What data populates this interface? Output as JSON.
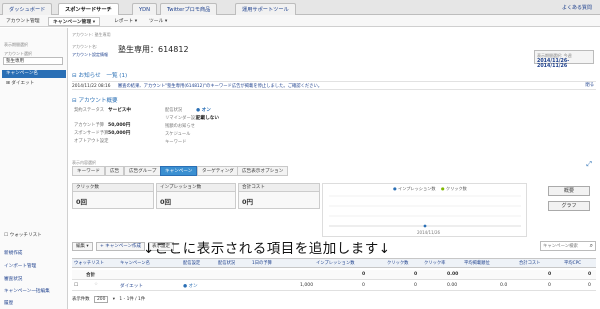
{
  "top_tabs": [
    "ダッシュボード",
    "スポンサードサーチ",
    "YDN",
    "Twitterプロモ商品",
    "運用サポートツール"
  ],
  "top_link": "よくある質問",
  "sub_menu": [
    "アカウント管理",
    "キャンペーン管理 ▾",
    "レポート ▾",
    "ツール ▾"
  ],
  "sidebar": {
    "label1": "表示期間選択",
    "label2": "アカウント選択",
    "account_select": "塾生専用",
    "tabs": [
      "キャンペーン名",
      "ダイエット"
    ],
    "watchlist": "ウォッチリスト",
    "links": [
      "新規作成",
      "インポート管理",
      "審査状況",
      "キャンペーン一括編集",
      "履歴"
    ]
  },
  "header": {
    "breadcrumb": "アカウント: 塾生専用",
    "acct_label1": "アカウント名:",
    "acct_label2": "アカウント設定情報",
    "acct_name": "塾生専用：614812",
    "date_label": "表示期間選択: 今週",
    "date_range": "2014/11/26-2014/11/26"
  },
  "notice": {
    "title": "お知らせ",
    "title_detail": "一覧 (1)",
    "date": "2014/11/22 08:16",
    "text": "審査の結果、アカウント\"塾生専用(614812)\"のキーワード広告が掲載を停止しました。ご確認ください。",
    "link": "閉る"
  },
  "acct_info": {
    "title": "アカウント概要",
    "keys": [
      "契約ステータス",
      "アカウント予算",
      "スポンサード予算",
      "オプトアウト設定"
    ],
    "vals": [
      "サービス中",
      "50,000円",
      "50,000円",
      ""
    ],
    "keys2": [
      "配信状況",
      "リマインダー設定",
      "残額のお知らせ",
      "スケジュール",
      "キーワード"
    ],
    "vals2": [
      "● オン",
      "記載しない",
      "",
      "",
      ""
    ]
  },
  "content_tabs": {
    "label": "表示内容選択",
    "items": [
      "キーワード",
      "広告",
      "広告グループ",
      "キャンペーン",
      "ターゲティング",
      "広告表示オプション"
    ],
    "active_index": 3
  },
  "metrics": [
    {
      "label": "クリック数",
      "value": "0回"
    },
    {
      "label": "インプレッション数",
      "value": "0回"
    },
    {
      "label": "合計コスト",
      "value": "0円"
    }
  ],
  "graph": {
    "legend": [
      "インプレッション数",
      "クリック数"
    ],
    "date": "2014/11/26"
  },
  "graph_buttons": [
    "概要",
    "グラフ"
  ],
  "toolbar": [
    "編集 ▾",
    "キャンペーン作成",
    "表示設定"
  ],
  "search_placeholder": "キャンペーン検索",
  "overlay_text": "↓ここに表示される項目を追加します↓",
  "table": {
    "headers": [
      "ウォッチリスト",
      "キャンペーン名",
      "配信設定",
      "配信状況",
      "1日の予算",
      "インプレッション数",
      "クリック数",
      "クリック率",
      "平均掲載順位",
      "合計コスト",
      "平均CPC"
    ],
    "total": {
      "label": "合計",
      "impressions": "0",
      "clicks": "0",
      "ctr": "0.00",
      "cost": "0",
      "cpc": "0"
    },
    "rows": [
      {
        "name": "ダイエット",
        "status": "● オン",
        "budget": "1,000",
        "impressions": "0",
        "clicks": "0",
        "ctr": "0.00",
        "pos": "0.0",
        "cost": "0",
        "cpc": "0"
      }
    ]
  },
  "footer": {
    "label": "表示件数",
    "per_page": "200",
    "range": "1 - 1件 / 1件"
  },
  "colors": {
    "accent": "#2a6fb5",
    "link": "#1b3e8c"
  }
}
